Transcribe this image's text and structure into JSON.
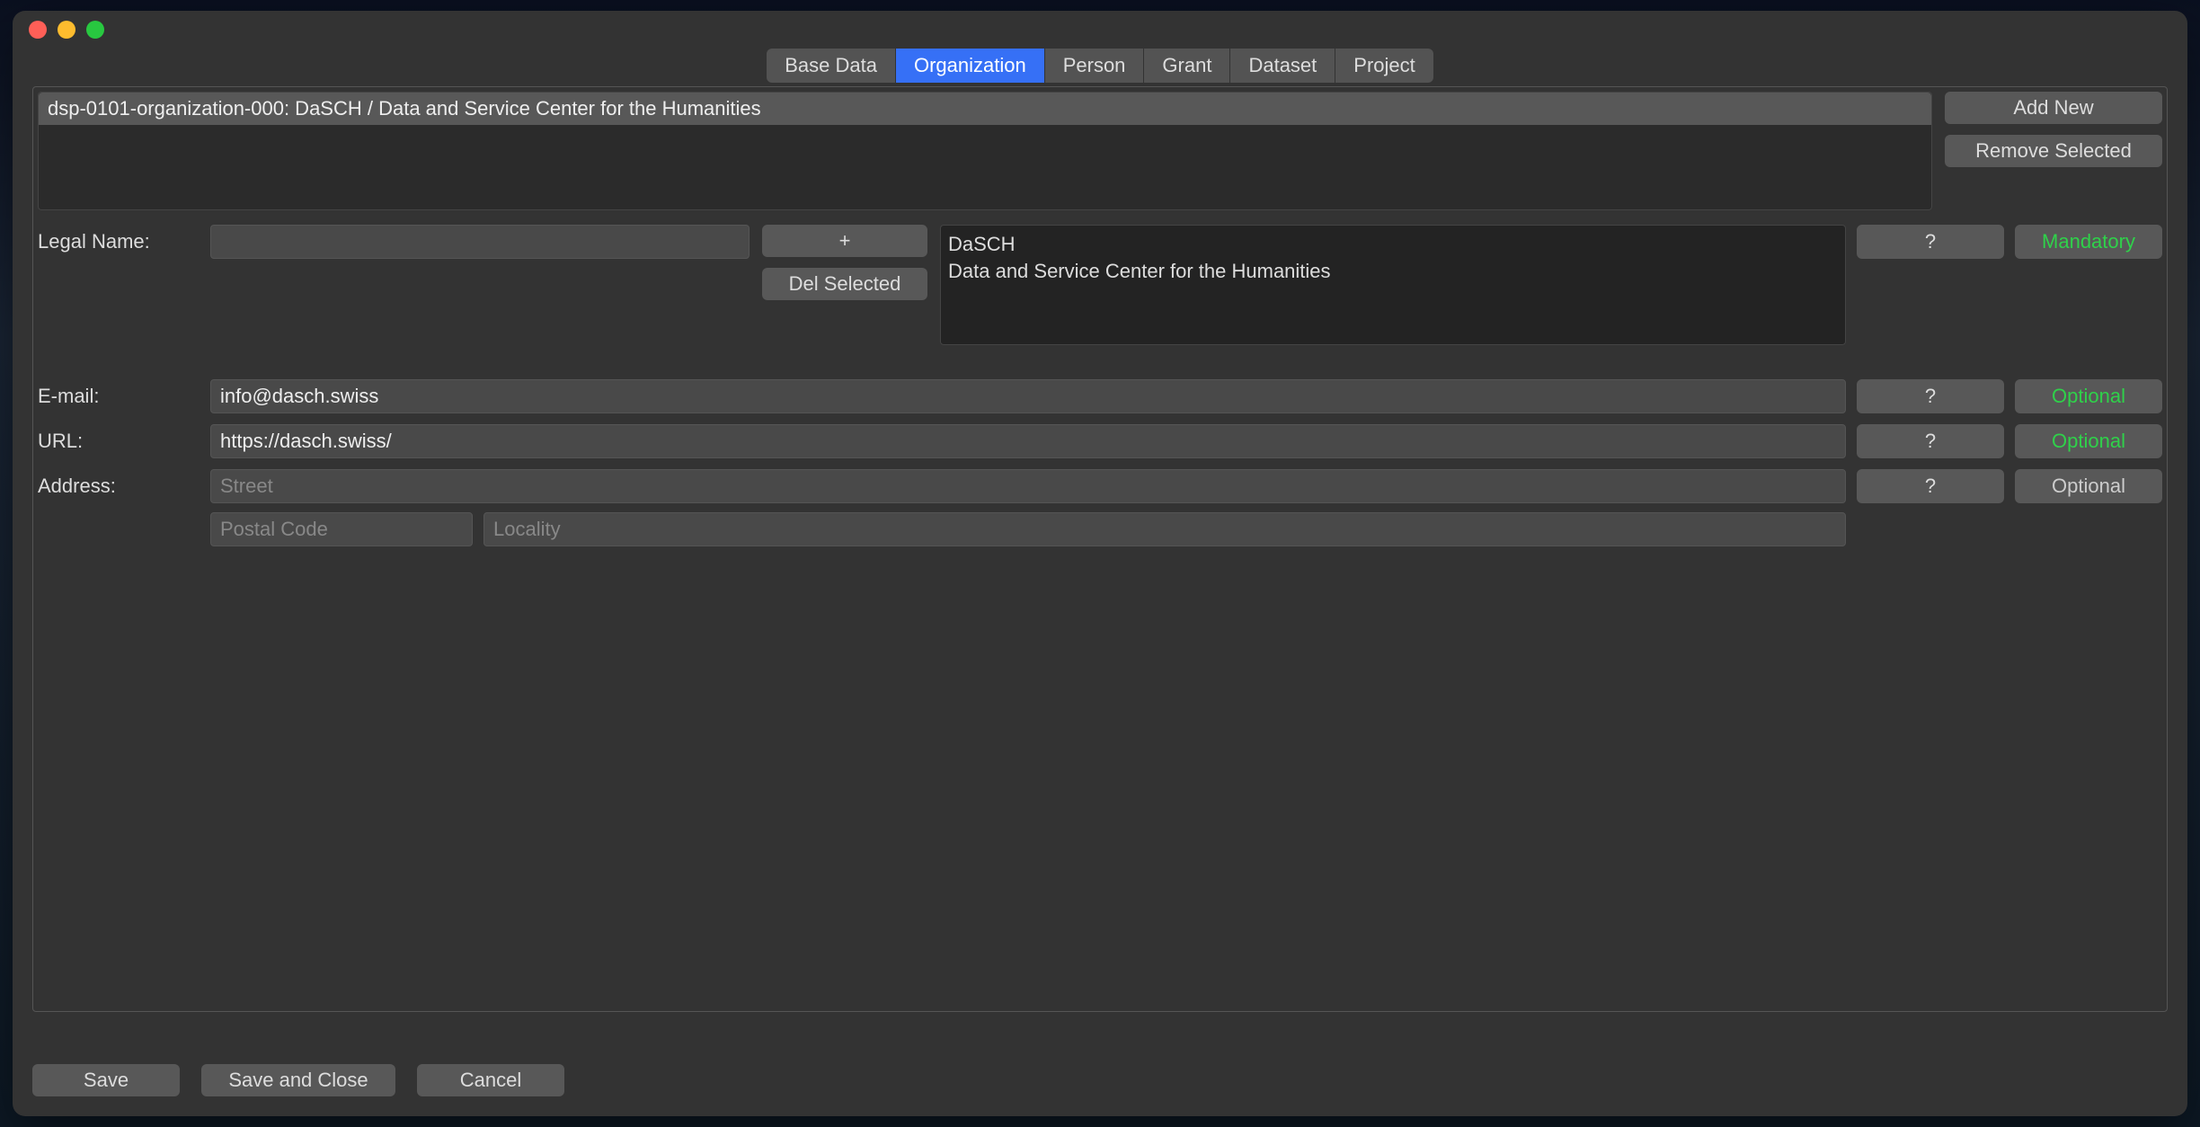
{
  "tabs": {
    "base_data": "Base Data",
    "organization": "Organization",
    "person": "Person",
    "grant": "Grant",
    "dataset": "Dataset",
    "project": "Project"
  },
  "org_list": {
    "items": [
      "dsp-0101-organization-000: DaSCH / Data and Service Center for the Humanities"
    ]
  },
  "side_buttons": {
    "add_new": "Add New",
    "remove_selected": "Remove Selected"
  },
  "fields": {
    "legal_name": {
      "label": "Legal Name:",
      "input_value": "",
      "add_btn": "+",
      "del_btn": "Del Selected",
      "names": [
        "DaSCH",
        "Data and Service Center for the Humanities"
      ],
      "help": "?",
      "status": "Mandatory"
    },
    "email": {
      "label": "E-mail:",
      "value": "info@dasch.swiss",
      "help": "?",
      "status": "Optional"
    },
    "url": {
      "label": "URL:",
      "value": "https://dasch.swiss/",
      "help": "?",
      "status": "Optional"
    },
    "address": {
      "label": "Address:",
      "street_placeholder": "Street",
      "postal_placeholder": "Postal Code",
      "locality_placeholder": "Locality",
      "help": "?",
      "status": "Optional"
    }
  },
  "bottom": {
    "save": "Save",
    "save_close": "Save and Close",
    "cancel": "Cancel"
  }
}
